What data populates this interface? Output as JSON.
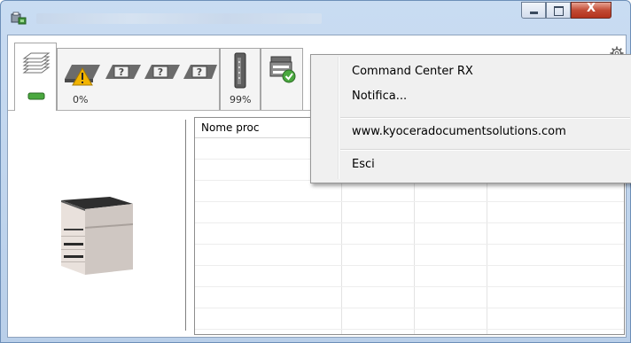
{
  "window": {
    "title_blurred": "",
    "buttons": {
      "minimize": "",
      "maximize": "",
      "close": "X"
    }
  },
  "toolbar": {
    "tab1_percent": "0%",
    "tab2_percent": "99%"
  },
  "icons": {
    "app": "printer-monitor-icon",
    "status_tab": "stack-of-paper-icon",
    "toner_tab": "toner-cartridge-icon",
    "device_tab": "mfp-device-icon",
    "settings": "gear-icon",
    "warning": "warning-icon",
    "unknown": "question-mark-icon"
  },
  "list": {
    "column_header": "Nome proc"
  },
  "menu": {
    "items": [
      "Command Center RX",
      "Notifica...",
      "www.kyoceradocumentsolutions.com",
      "Esci"
    ]
  },
  "colors": {
    "titlebar": "#c9dcf2",
    "close_button": "#c24b35",
    "menu_bg": "#f0f0f0",
    "warning": "#f2b400"
  }
}
